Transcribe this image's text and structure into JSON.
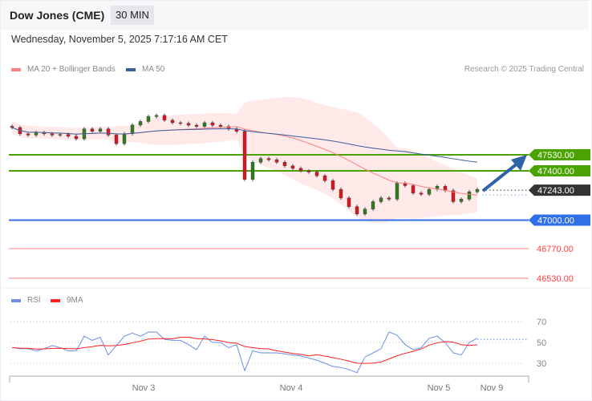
{
  "header": {
    "title": "Dow Jones (CME)",
    "timeframe": "30 MIN",
    "date": "Wednesday, November 5, 2025 7:17:16 AM CET"
  },
  "legend": {
    "ma20": "MA 20 + Bollinger Bands",
    "ma50": "MA 50",
    "credit": "Research © 2025 Trading Central",
    "rsi": "RSI",
    "rsi_ma": "9MA"
  },
  "colors": {
    "up": "#2e7d1e",
    "down": "#e0151b",
    "ma20": "#ff8080",
    "ma50": "#3a5fa0",
    "band": "#ffe4e4",
    "resistance": "#4aa300",
    "support": "#2f6fe8",
    "current": "#333333",
    "red_level": "#ff4040",
    "rsi": "#6b8ee8",
    "rsi_ma": "#ff2020",
    "arrow": "#2f63a8"
  },
  "chart_data": [
    {
      "type": "candlestick",
      "title": "Dow Jones (CME) 30 MIN",
      "closes": [
        47751,
        47700,
        47690,
        47710,
        47700,
        47690,
        47695,
        47680,
        47660,
        47740,
        47720,
        47740,
        47690,
        47620,
        47700,
        47771,
        47800,
        47840,
        47849,
        47810,
        47790,
        47785,
        47770,
        47760,
        47790,
        47770,
        47760,
        47740,
        47720,
        47330,
        47470,
        47500,
        47490,
        47470,
        47440,
        47420,
        47400,
        47390,
        47360,
        47320,
        47250,
        47180,
        47110,
        47050,
        47090,
        47150,
        47180,
        47170,
        47300,
        47280,
        47220,
        47210,
        47250,
        47275,
        47240,
        47150,
        47170,
        47230,
        47250
      ],
      "levels": [
        {
          "value": "47530.00",
          "kind": "resistance"
        },
        {
          "value": "47400.00",
          "kind": "resistance"
        },
        {
          "value": "47243.00",
          "kind": "current"
        },
        {
          "value": "47000.00",
          "kind": "support"
        },
        {
          "value": "46770.00",
          "kind": "red_level"
        },
        {
          "value": "46530.00",
          "kind": "red_level"
        }
      ],
      "indicators": [
        "MA 20 + Bollinger Bands",
        "MA 50"
      ]
    },
    {
      "type": "line",
      "title": "RSI",
      "rsi": [
        45,
        44,
        44,
        42,
        44,
        47,
        45,
        42,
        42,
        56,
        52,
        55,
        38,
        47,
        56,
        59,
        56,
        60,
        60,
        53,
        52,
        52,
        48,
        43,
        56,
        50,
        50,
        45,
        48,
        23,
        42,
        40,
        40,
        40,
        39,
        38,
        37,
        35,
        33,
        30,
        27,
        26,
        24,
        21,
        36,
        40,
        44,
        60,
        57,
        48,
        43,
        45,
        54,
        56,
        50,
        40,
        38,
        50,
        54
      ],
      "ma_period": 9,
      "yticks": [
        "70",
        "50",
        "30"
      ],
      "ylim": [
        30,
        70
      ]
    }
  ],
  "xaxis": {
    "ticks": [
      "Nov 3",
      "Nov 4",
      "Nov 5",
      "Nov 9"
    ]
  }
}
